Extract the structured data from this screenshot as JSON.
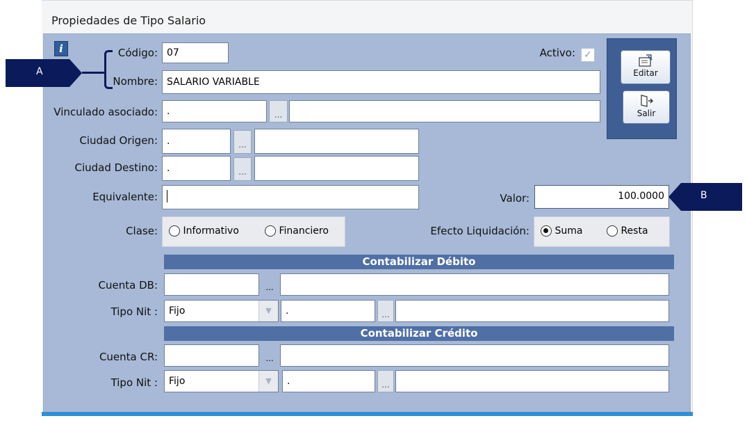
{
  "window": {
    "title": "Propiedades de Tipo Salario"
  },
  "callouts": {
    "a": "A",
    "b": "B"
  },
  "fields": {
    "codigo": {
      "label": "Código:",
      "value": "07"
    },
    "activo": {
      "label": "Activo:",
      "checked": true
    },
    "nombre": {
      "label": "Nombre:",
      "value": "SALARIO VARIABLE"
    },
    "vinculado": {
      "label": "Vinculado asociado:",
      "value": ".",
      "dots": "...",
      "desc": ""
    },
    "ciudad_origen": {
      "label": "Ciudad Origen:",
      "value": ".",
      "dots": "...",
      "desc": ""
    },
    "ciudad_destino": {
      "label": "Ciudad Destino:",
      "value": ".",
      "dots": "...",
      "desc": ""
    },
    "equivalente": {
      "label": "Equivalente:",
      "value": ""
    },
    "valor": {
      "label": "Valor:",
      "value": "100.0000"
    },
    "clase": {
      "label": "Clase:",
      "options": [
        "Informativo",
        "Financiero"
      ],
      "selected": null
    },
    "efecto": {
      "label": "Efecto Liquidación:",
      "options": [
        "Suma",
        "Resta"
      ],
      "selected": "Suma"
    }
  },
  "debito": {
    "title": "Contabilizar Débito",
    "cuenta": {
      "label": "Cuenta DB:",
      "value": "",
      "dots": "...",
      "desc": ""
    },
    "tipo_nit": {
      "label": "Tipo Nit :",
      "value": "Fijo",
      "nit": ".",
      "dots": "...",
      "desc": ""
    }
  },
  "credito": {
    "title": "Contabilizar Crédito",
    "cuenta": {
      "label": "Cuenta CR:",
      "value": "",
      "dots": "...",
      "desc": ""
    },
    "tipo_nit": {
      "label": "Tipo Nit :",
      "value": "Fijo",
      "nit": ".",
      "dots": "...",
      "desc": ""
    }
  },
  "toolbar": {
    "editar": "Editar",
    "salir": "Salir"
  },
  "icons": {
    "info": "info-icon",
    "edit": "edit-icon",
    "exit": "exit-door-icon"
  },
  "colors": {
    "panel": "#a7b9d6",
    "section": "#4f6fa5",
    "callout": "#0a1a5a"
  }
}
